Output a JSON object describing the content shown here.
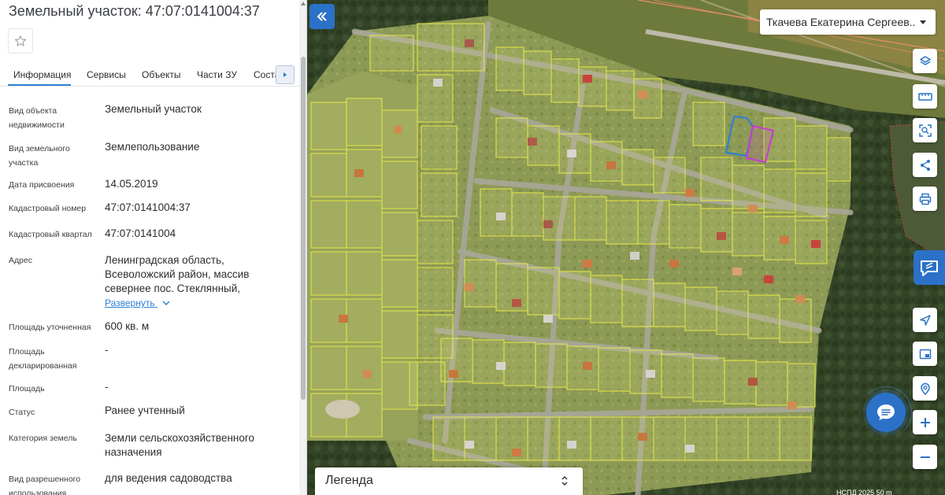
{
  "panel": {
    "title": "Земельный участок: 47:07:0141004:37",
    "tabs": [
      "Информация",
      "Сервисы",
      "Объекты",
      "Части ЗУ",
      "Соста"
    ],
    "active_tab": "Информация",
    "expand_label": "Развернуть",
    "rows": [
      {
        "label": "Вид объекта недвижимости",
        "value": "Земельный участок"
      },
      {
        "label": "Вид земельного участка",
        "value": "Землепользование"
      },
      {
        "label": "Дата присвоения",
        "value": "14.05.2019"
      },
      {
        "label": "Кадастровый номер",
        "value": "47:07:0141004:37"
      },
      {
        "label": "Кадастровый квартал",
        "value": "47:07:0141004"
      },
      {
        "label": "Адрес",
        "value": "Ленинградская область, Всеволожский район, массив севернее пос. Стеклянный,"
      },
      {
        "label": "Площадь уточненная",
        "value": "600 кв. м"
      },
      {
        "label": "Площадь декларированная",
        "value": "-"
      },
      {
        "label": "Площадь",
        "value": "-"
      },
      {
        "label": "Статус",
        "value": "Ранее учтенный"
      },
      {
        "label": "Категория земель",
        "value": "Земли сельскохозяйственного назначения"
      },
      {
        "label": "Вид разрешенного использования",
        "value": "для ведения садоводства"
      }
    ]
  },
  "map": {
    "user_name": "Ткачева Екатерина Сергеев...",
    "legend_label": "Легенда",
    "attribution": "НСПД 2025    50 m",
    "tools": [
      "layers-icon",
      "ruler-icon",
      "select-area-icon",
      "share-icon",
      "print-icon"
    ],
    "nav_tools": [
      "locate-icon",
      "minimap-icon",
      "search-location-icon",
      "zoom-in-icon",
      "zoom-out-icon"
    ],
    "colors": {
      "accent": "#2b71c8",
      "parcel_outline": "#e6e84a",
      "selected_parcel": "#2f7fd6",
      "highlight_parcel": "#c83ad1"
    }
  }
}
